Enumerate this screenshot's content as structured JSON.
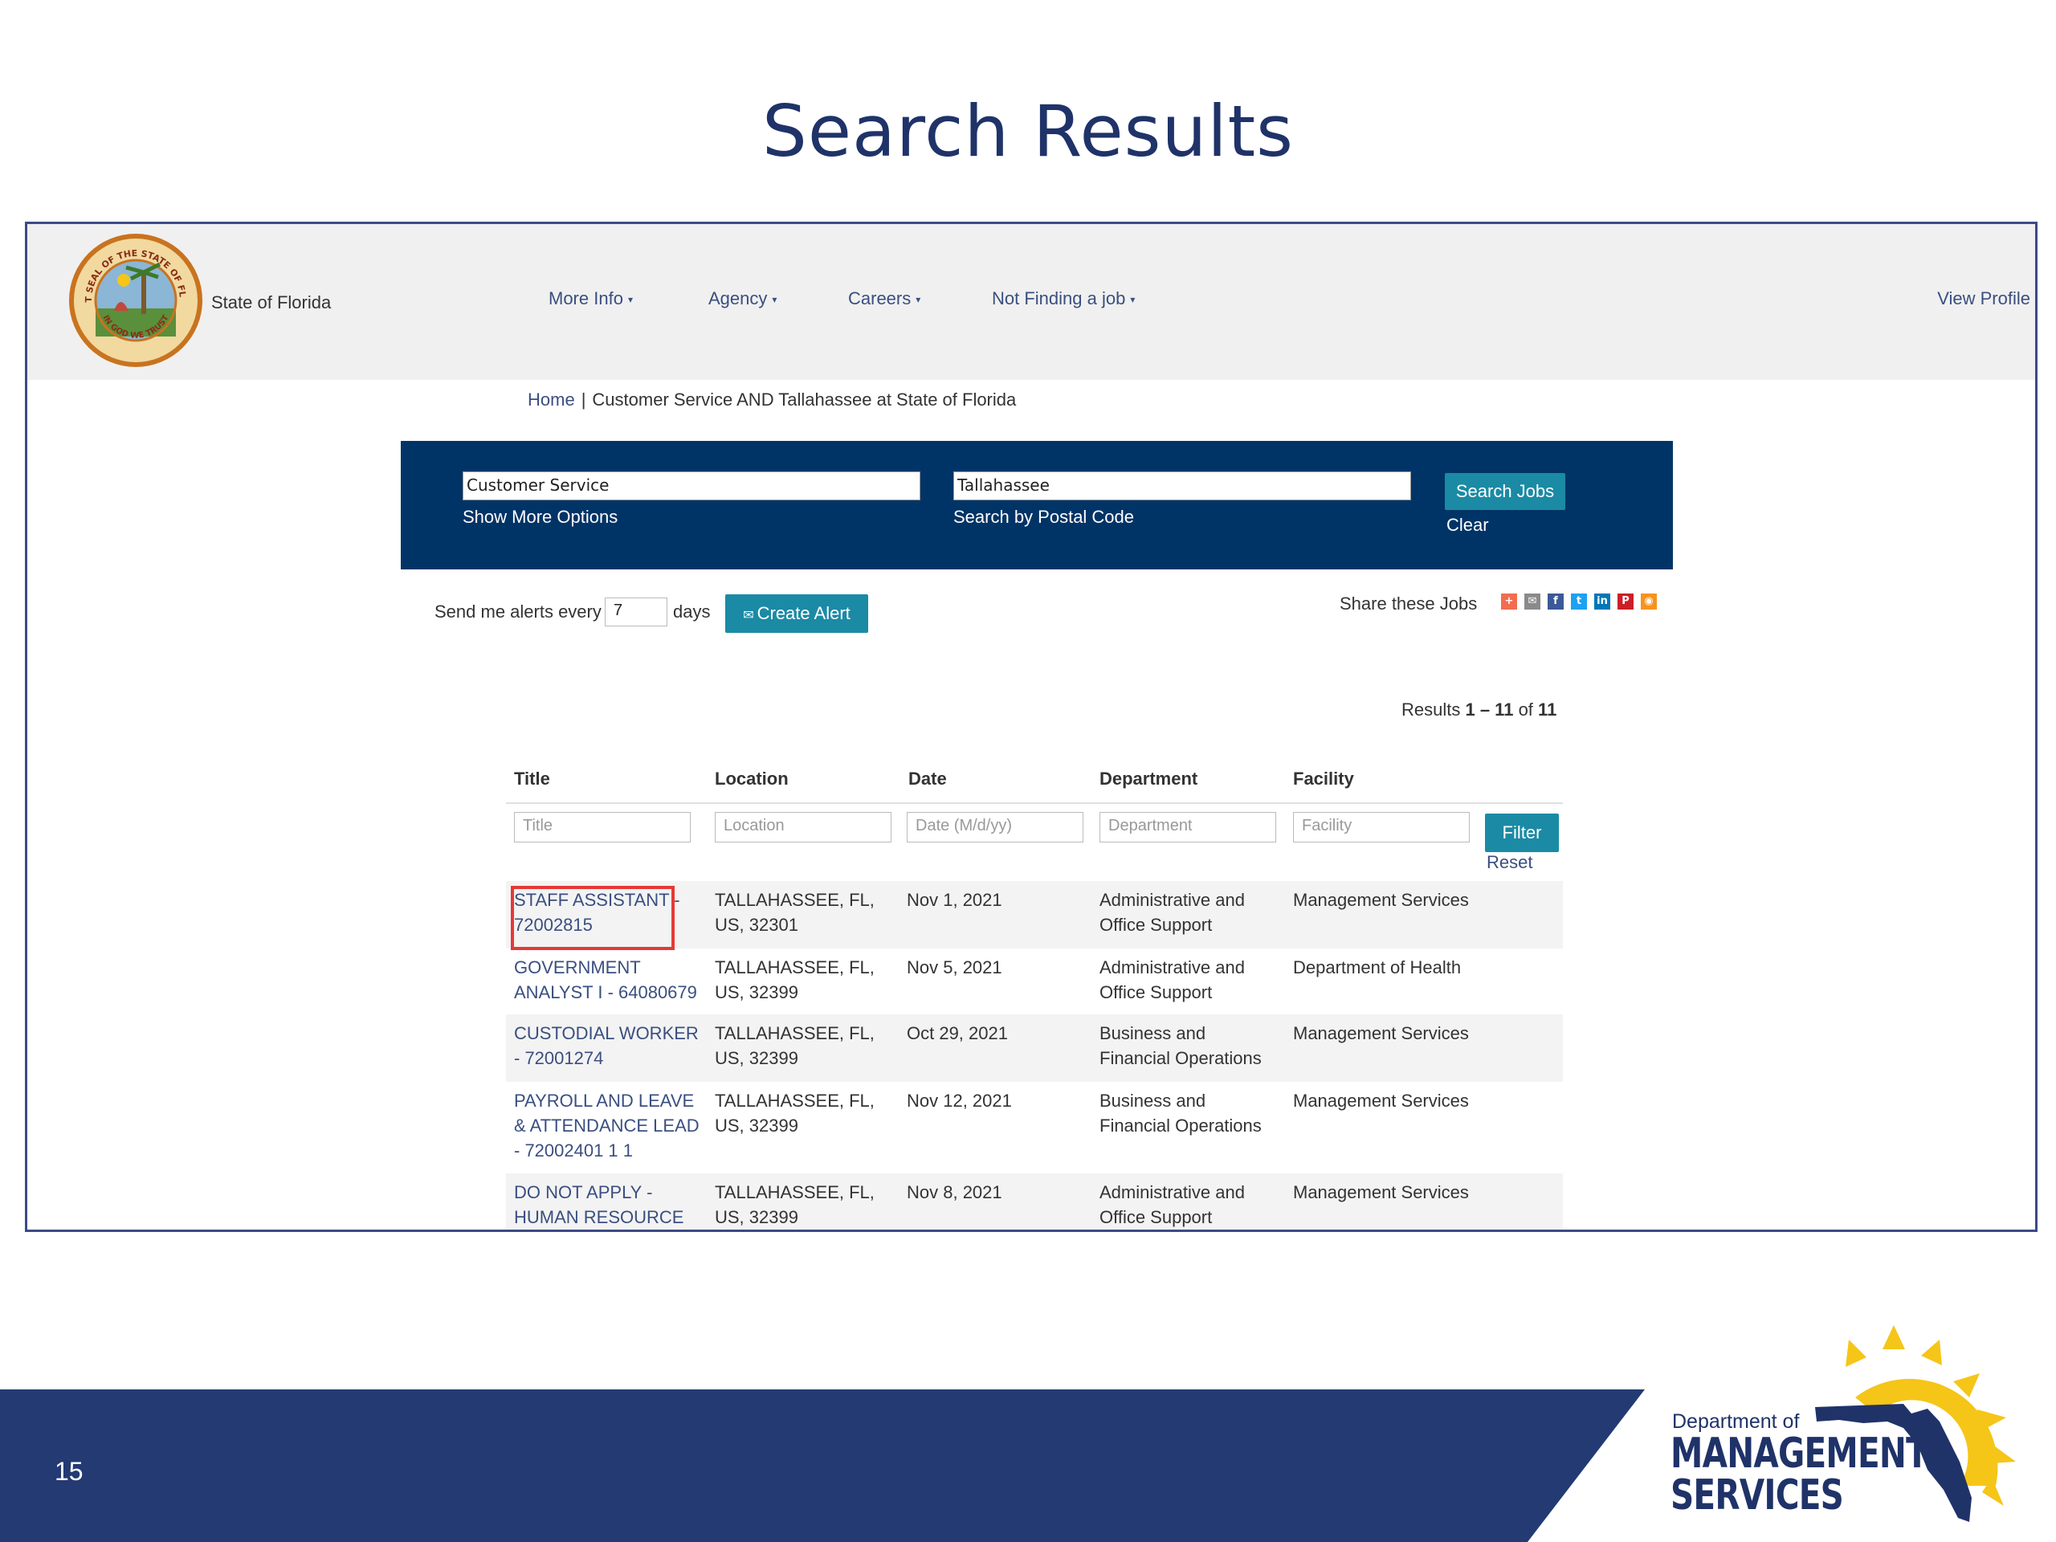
{
  "slide": {
    "title": "Search Results",
    "page_number": "15"
  },
  "header": {
    "site_name": "State of Florida",
    "nav": [
      {
        "label": "More Info"
      },
      {
        "label": "Agency"
      },
      {
        "label": "Careers"
      },
      {
        "label": "Not Finding a job"
      }
    ],
    "view_profile": "View Profile"
  },
  "breadcrumb": {
    "home": "Home",
    "separator": "|",
    "current": "Customer Service AND Tallahassee at State of Florida"
  },
  "search": {
    "keyword_value": "Customer Service",
    "location_value": "Tallahassee",
    "show_more": "Show More Options",
    "postal_code": "Search by Postal Code",
    "search_button": "Search Jobs",
    "clear": "Clear"
  },
  "alerts": {
    "label_prefix": "Send me alerts every",
    "days_value": "7",
    "label_suffix": "days",
    "create_button": "Create Alert"
  },
  "share": {
    "label": "Share these Jobs",
    "icons": [
      {
        "name": "addthis-icon",
        "glyph": "+",
        "color": "#f26c4f"
      },
      {
        "name": "email-icon",
        "glyph": "✉",
        "color": "#8a8a8a"
      },
      {
        "name": "facebook-icon",
        "glyph": "f",
        "color": "#3b5998"
      },
      {
        "name": "twitter-icon",
        "glyph": "t",
        "color": "#1da1f2"
      },
      {
        "name": "linkedin-icon",
        "glyph": "in",
        "color": "#0077b5"
      },
      {
        "name": "pinterest-icon",
        "glyph": "P",
        "color": "#cb2027"
      },
      {
        "name": "rss-icon",
        "glyph": "◉",
        "color": "#f7931e"
      }
    ]
  },
  "results": {
    "prefix": "Results",
    "range": "1 – 11",
    "of": "of",
    "total": "11"
  },
  "table": {
    "columns": [
      "Title",
      "Location",
      "Date",
      "Department",
      "Facility"
    ],
    "filter_placeholders": [
      "Title",
      "Location",
      "Date (M/d/yy)",
      "Department",
      "Facility"
    ],
    "filter_button": "Filter",
    "reset": "Reset",
    "rows": [
      {
        "title": "STAFF ASSISTANT - 72002815",
        "location": "TALLAHASSEE, FL, US, 32301",
        "date": "Nov 1, 2021",
        "department": "Administrative and Office Support",
        "facility": "Management Services"
      },
      {
        "title": "GOVERNMENT ANALYST I - 64080679",
        "location": "TALLAHASSEE, FL, US, 32399",
        "date": "Nov 5, 2021",
        "department": "Administrative and Office Support",
        "facility": "Department of Health"
      },
      {
        "title": "CUSTODIAL WORKER - 72001274",
        "location": "TALLAHASSEE, FL, US, 32399",
        "date": "Oct 29, 2021",
        "department": "Business and Financial Operations",
        "facility": "Management Services"
      },
      {
        "title": "PAYROLL AND LEAVE & ATTENDANCE LEAD - 72002401 1 1",
        "location": "TALLAHASSEE, FL, US, 32399",
        "date": "Nov 12, 2021",
        "department": "Business and Financial Operations",
        "facility": "Management Services"
      },
      {
        "title": "DO NOT APPLY - HUMAN RESOURCE",
        "location": "TALLAHASSEE, FL, US, 32399",
        "date": "Nov 8, 2021",
        "department": "Administrative and Office Support",
        "facility": "Management Services"
      }
    ]
  },
  "logo": {
    "line1": "Department of",
    "line2": "MANAGEMENT",
    "line3": "SERVICES",
    "seal_text_top": "GREAT SEAL OF THE STATE OF FLORIDA",
    "seal_text_bottom": "IN GOD WE TRUST"
  },
  "colors": {
    "title_navy": "#1f3369",
    "footer_navy": "#233a73",
    "search_band": "#013466",
    "button_teal": "#1b8aa5",
    "highlight_red": "#e53935",
    "logo_yellow": "#f5c518"
  }
}
